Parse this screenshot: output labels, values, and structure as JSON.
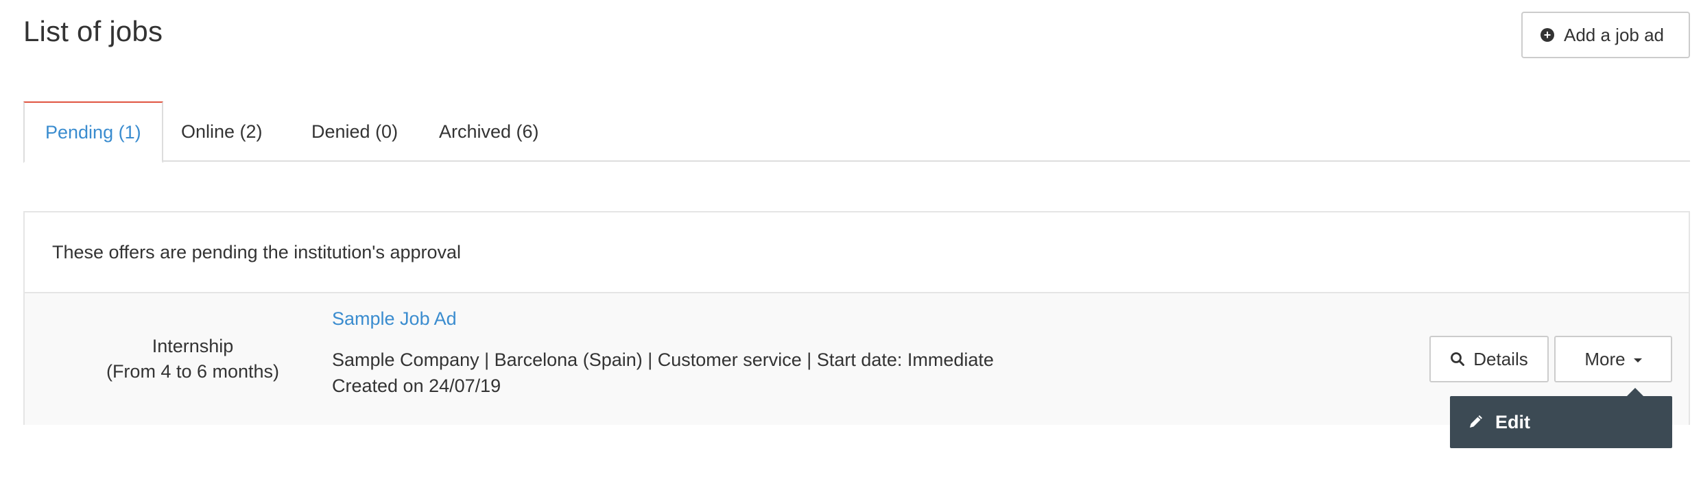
{
  "header": {
    "title": "List of jobs",
    "add_button_label": "Add a job ad",
    "add_button_icon": "plus-circle-icon"
  },
  "tabs": [
    {
      "label": "Pending (1)",
      "active": true
    },
    {
      "label": "Online (2)",
      "active": false
    },
    {
      "label": "Denied (0)",
      "active": false
    },
    {
      "label": "Archived (6)",
      "active": false
    }
  ],
  "panel": {
    "notice": "These offers are pending the institution's approval",
    "jobs": [
      {
        "type_line1": "Internship",
        "type_line2": "(From 4 to 6 months)",
        "title": "Sample Job Ad",
        "meta_line1": "Sample Company | Barcelona (Spain) | Customer service | Start date: Immediate",
        "meta_line2": "Created on 24/07/19",
        "details_label": "Details",
        "details_icon": "search-icon",
        "more_label": "More"
      }
    ]
  },
  "dropdown": {
    "items": [
      {
        "label": "Edit",
        "icon": "pencil-icon"
      }
    ]
  },
  "colors": {
    "accent_link": "#3a8ccf",
    "active_tab_border": "#e05440",
    "dropdown_bg": "#3c4a54"
  }
}
